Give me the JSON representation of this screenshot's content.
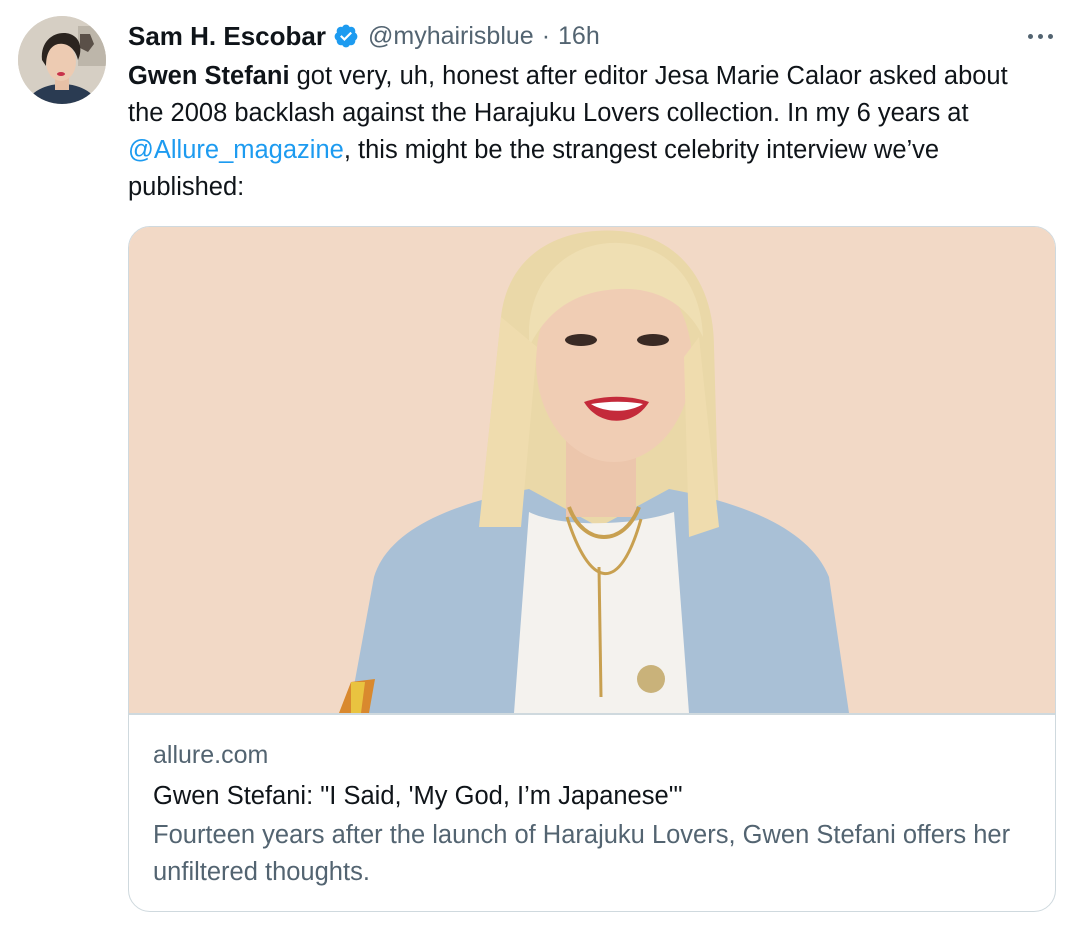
{
  "author": {
    "display_name": "Sam H. Escobar",
    "handle": "@myhairisblue",
    "separator": "·",
    "time": "16h",
    "verified_color": "#1d9bf0"
  },
  "tweet": {
    "bold_name": "Gwen Stefani",
    "text_1": " got very, uh, honest after editor Jesa Marie Calaor asked about the 2008 backlash against the Harajuku Lovers collection. In my 6 years at ",
    "mention": "@Allure_magazine",
    "text_2": ", this might be the strangest celebrity interview we’ve published:"
  },
  "card": {
    "domain": "allure.com",
    "title": "Gwen Stefani: \"I Said, 'My God, I’m Japanese'\"",
    "description": "Fourteen years after the launch of Harajuku Lovers, Gwen Stefani offers her unfiltered thoughts."
  },
  "colors": {
    "link": "#1d9bf0",
    "secondary_text": "#536471",
    "card_background": "#f2d9c6",
    "border": "#cfd9de"
  }
}
